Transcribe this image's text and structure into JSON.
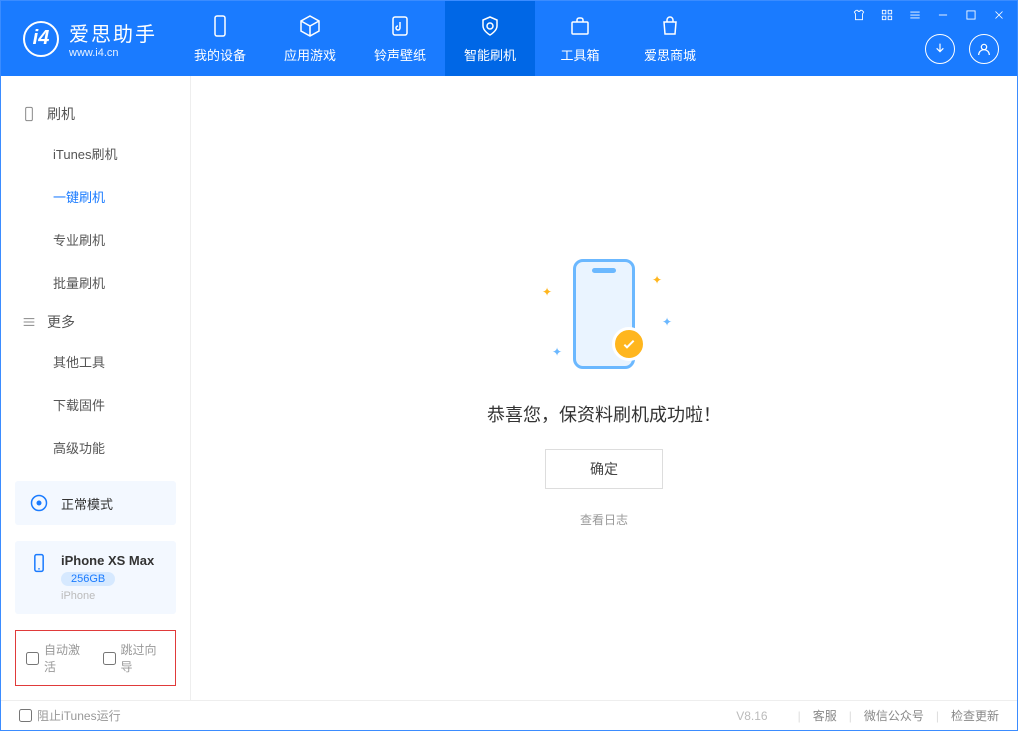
{
  "app": {
    "name_cn": "爱思助手",
    "name_en": "www.i4.cn",
    "logo_letter": "i4"
  },
  "nav": {
    "items": [
      {
        "label": "我的设备"
      },
      {
        "label": "应用游戏"
      },
      {
        "label": "铃声壁纸"
      },
      {
        "label": "智能刷机"
      },
      {
        "label": "工具箱"
      },
      {
        "label": "爱思商城"
      }
    ],
    "active_index": 3
  },
  "window_controls": [
    "tshirt-icon",
    "grid-icon",
    "menu-icon",
    "minimize",
    "maximize",
    "close"
  ],
  "header_right": [
    "download-icon",
    "user-icon"
  ],
  "sidebar": {
    "groups": [
      {
        "title": "刷机",
        "icon": "phone-icon",
        "items": [
          "iTunes刷机",
          "一键刷机",
          "专业刷机",
          "批量刷机"
        ],
        "active_index": 1
      },
      {
        "title": "更多",
        "icon": "list-icon",
        "items": [
          "其他工具",
          "下载固件",
          "高级功能"
        ],
        "active_index": -1
      }
    ]
  },
  "mode": {
    "label": "正常模式"
  },
  "device": {
    "name": "iPhone XS Max",
    "capacity": "256GB",
    "type": "iPhone"
  },
  "sidebar_checks": {
    "auto_activate": "自动激活",
    "skip_guide": "跳过向导"
  },
  "main": {
    "success": "恭喜您，保资料刷机成功啦！",
    "confirm": "确定",
    "view_log": "查看日志"
  },
  "footer": {
    "block_itunes": "阻止iTunes运行",
    "version": "V8.16",
    "links": [
      "客服",
      "微信公众号",
      "检查更新"
    ]
  }
}
